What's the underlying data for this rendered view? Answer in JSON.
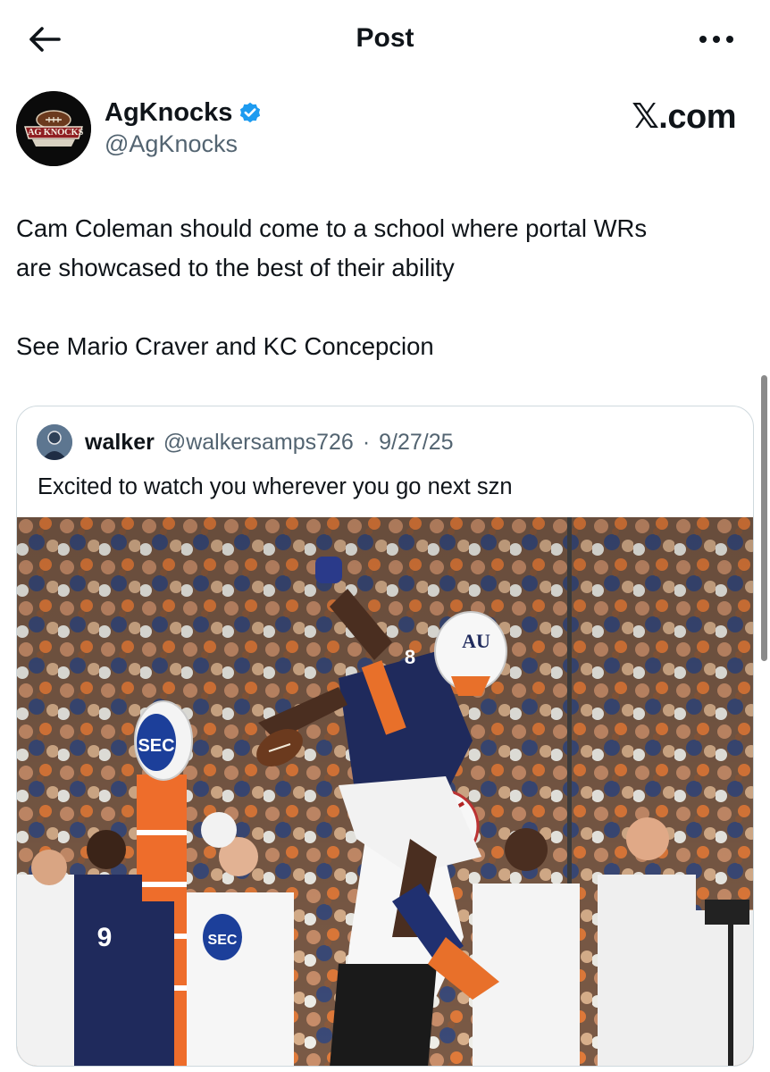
{
  "header": {
    "title": "Post",
    "back_icon": "arrow-left-icon",
    "more_icon": "more-dots-icon"
  },
  "post": {
    "author_name": "AgKnocks",
    "author_handle": "@AgKnocks",
    "verified_icon": "verified-badge-icon",
    "avatar_text": "AG KNOCKS",
    "watermark": "𝕏.com",
    "text_lines": [
      "Cam Coleman should come to a school where portal WRs",
      "are showcased to the best of their ability",
      "See Mario Craver and KC Concepcion"
    ]
  },
  "quote": {
    "author_name": "walker",
    "author_handle": "@walkersamps726",
    "separator": "·",
    "date": "9/27/25",
    "text": "Excited to watch you wherever you go next szn",
    "media": {
      "description_icon": "football-photo-icon",
      "jersey_number": "8",
      "sign_text": "SEC",
      "shirt_logo_text": "SEC",
      "helmet_logo": "AU",
      "bench_jersey_number": "9"
    }
  },
  "colors": {
    "text_primary": "#0f1419",
    "text_secondary": "#536471",
    "verified_blue": "#1d9bf0",
    "border": "#cfd9de",
    "auburn_navy": "#1f2a5c",
    "auburn_orange": "#e8702a"
  }
}
